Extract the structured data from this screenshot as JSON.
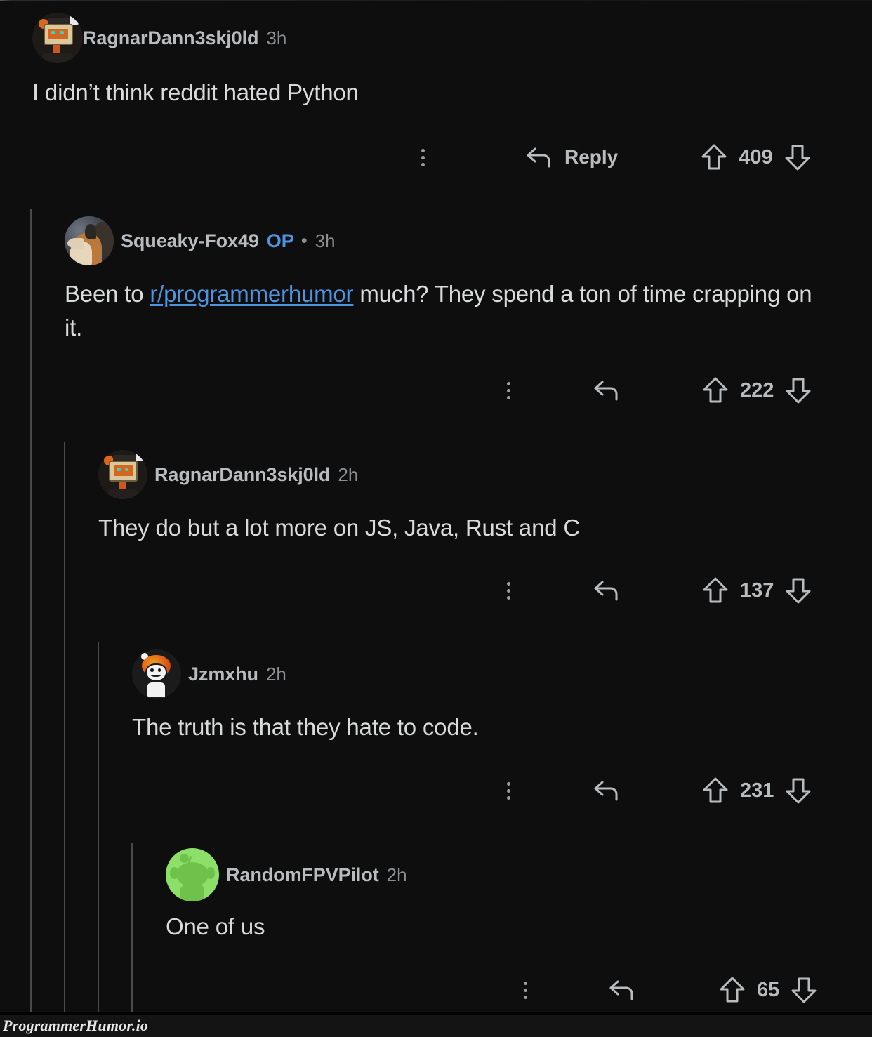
{
  "meta": {
    "watermark": "ProgrammerHumor.io",
    "accent_link_color": "#4f93e0",
    "background_color": "#0e0e0e",
    "text_color": "#d8dadb",
    "muted_text_color": "#8b8f91"
  },
  "thread": {
    "comments": [
      {
        "id": "c1",
        "depth": 0,
        "username": "RagnarDann3skj0ld",
        "op": false,
        "op_label": "",
        "separator": "",
        "timestamp": "3h",
        "avatar": "pixel-monitor-avatar",
        "body_prefix": "I didn’t think reddit hated Python",
        "body_link": "",
        "body_suffix": "",
        "reply_label": "Reply",
        "votes": "409"
      },
      {
        "id": "c2",
        "depth": 1,
        "username": "Squeaky-Fox49",
        "op": true,
        "op_label": "OP",
        "separator": "•",
        "timestamp": "3h",
        "avatar": "fox-photo-avatar",
        "body_prefix": "Been to ",
        "body_link": "r/programmerhumor",
        "body_suffix": " much? They spend a ton of time crapping on it.",
        "reply_label": "",
        "votes": "222"
      },
      {
        "id": "c3",
        "depth": 2,
        "username": "RagnarDann3skj0ld",
        "op": false,
        "op_label": "",
        "separator": "",
        "timestamp": "2h",
        "avatar": "pixel-monitor-avatar",
        "body_prefix": "They do but a lot more on JS, Java, Rust and C",
        "body_link": "",
        "body_suffix": "",
        "reply_label": "",
        "votes": "137"
      },
      {
        "id": "c4",
        "depth": 3,
        "username": "Jzmxhu",
        "op": false,
        "op_label": "",
        "separator": "",
        "timestamp": "2h",
        "avatar": "snoo-orange-avatar",
        "body_prefix": "The truth is that they hate to code.",
        "body_link": "",
        "body_suffix": "",
        "reply_label": "",
        "votes": "231"
      },
      {
        "id": "c5",
        "depth": 4,
        "username": "RandomFPVPilot",
        "op": false,
        "op_label": "",
        "separator": "",
        "timestamp": "2h",
        "avatar": "snoo-green-avatar",
        "body_prefix": "One of us",
        "body_link": "",
        "body_suffix": "",
        "reply_label": "",
        "votes": "65"
      }
    ]
  },
  "icons": {
    "kebab": "more-options-icon",
    "reply": "reply-arrow-icon",
    "upvote": "upvote-arrow-icon",
    "downvote": "downvote-arrow-icon"
  }
}
